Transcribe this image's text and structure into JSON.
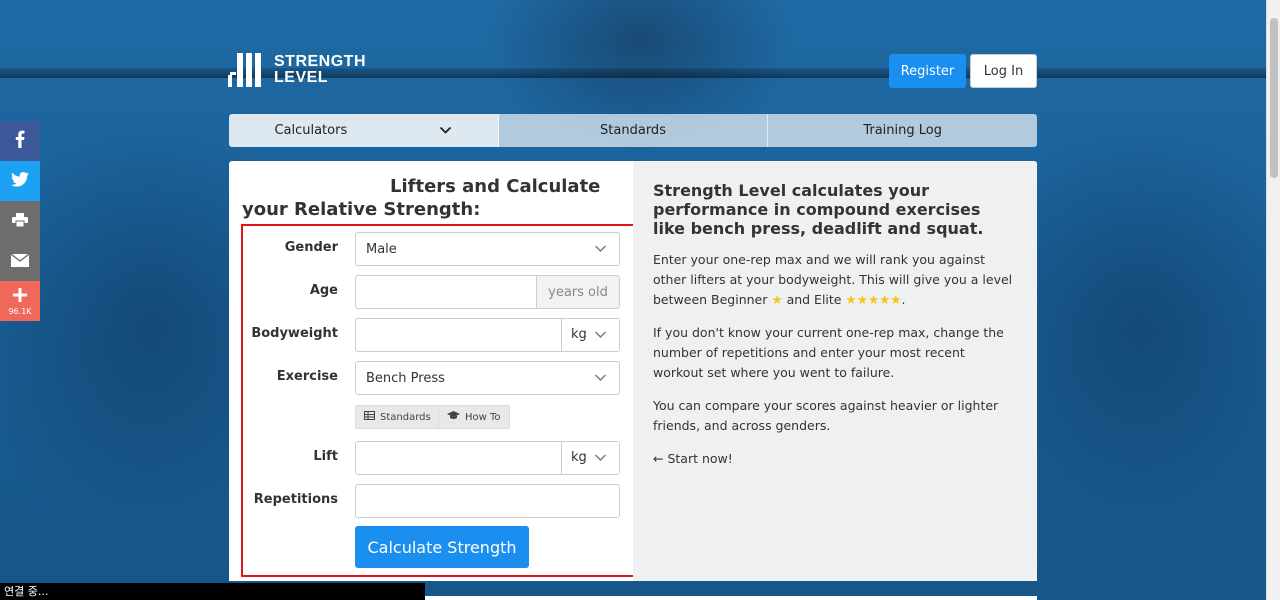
{
  "logo": {
    "line1": "STRENGTH",
    "line2": "LEVEL"
  },
  "header": {
    "register_label": "Register",
    "login_label": "Log In"
  },
  "nav": {
    "items": [
      {
        "label": "Calculators",
        "active": true
      },
      {
        "label": "Standards",
        "active": false
      },
      {
        "label": "Training Log",
        "active": false
      }
    ]
  },
  "form": {
    "title_line1": "Lifters and Calculate",
    "title_line2": "your Relative Strength:",
    "gender": {
      "label": "Gender",
      "value": "Male"
    },
    "age": {
      "label": "Age",
      "value": "",
      "suffix": "years old"
    },
    "bodyweight": {
      "label": "Bodyweight",
      "value": "",
      "unit": "kg"
    },
    "exercise": {
      "label": "Exercise",
      "value": "Bench Press"
    },
    "standards_label": "Standards",
    "howto_label": "How To",
    "lift": {
      "label": "Lift",
      "value": "",
      "unit": "kg"
    },
    "repetitions": {
      "label": "Repetitions",
      "value": ""
    },
    "calculate_label": "Calculate Strength"
  },
  "info": {
    "heading": "Strength Level calculates your performance in compound exercises like bench press, deadlift and squat.",
    "p1_a": "Enter your one-rep max and we will rank you against other lifters at your bodyweight. This will give you a level between Beginner",
    "p1_star1": "★",
    "p1_b": "and Elite",
    "p1_star5": "★★★★★",
    "p1_c": ".",
    "p2": "If you don't know your current one-rep max, change the number of repetitions and enter your most recent workout set where you went to failure.",
    "p3": "You can compare your scores against heavier or lighter friends, and across genders.",
    "p4": "← Start now!"
  },
  "social": {
    "share_count": "96.1K"
  },
  "status_text": "연결 중...",
  "colors": {
    "primary": "#1a8ff0",
    "highlight_border": "#e0151b",
    "background": "#1a5e96"
  }
}
